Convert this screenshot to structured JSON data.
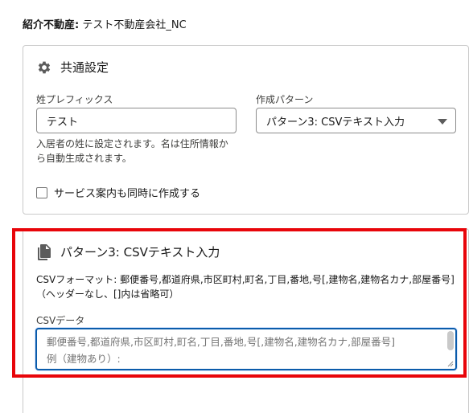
{
  "agency": {
    "label": "紹介不動産:",
    "value": "テスト不動産会社_NC"
  },
  "common": {
    "title": "共通設定",
    "icon": "gear-icon",
    "prefix_label": "姓プレフィックス",
    "prefix_value": "テスト",
    "prefix_help_line1": "入居者の姓に設定されます。名は住所情報か",
    "prefix_help_line2": "ら自動生成されます。",
    "pattern_label": "作成パターン",
    "pattern_value": "パターン3: CSVテキスト入力",
    "service_checkbox_label": "サービス案内も同時に作成する",
    "service_checked": false
  },
  "pattern3": {
    "title": "パターン3: CSVテキスト入力",
    "icon": "document-icon",
    "format_line1": "CSVフォーマット: 郵便番号,都道府県,市区町村,町名,丁目,番地,号[,建物名,建物名カナ,部屋番号]",
    "format_line2": "（ヘッダーなし、[]内は省略可）",
    "csv_label": "CSVデータ",
    "placeholder_line1": "郵便番号,都道府県,市区町村,町名,丁目,番地,号[,建物名,建物名カナ,部屋番号]",
    "placeholder_line2": "例（建物あり）:"
  },
  "colors": {
    "focus_border": "#0b5cab",
    "highlight": "#e8050a"
  }
}
